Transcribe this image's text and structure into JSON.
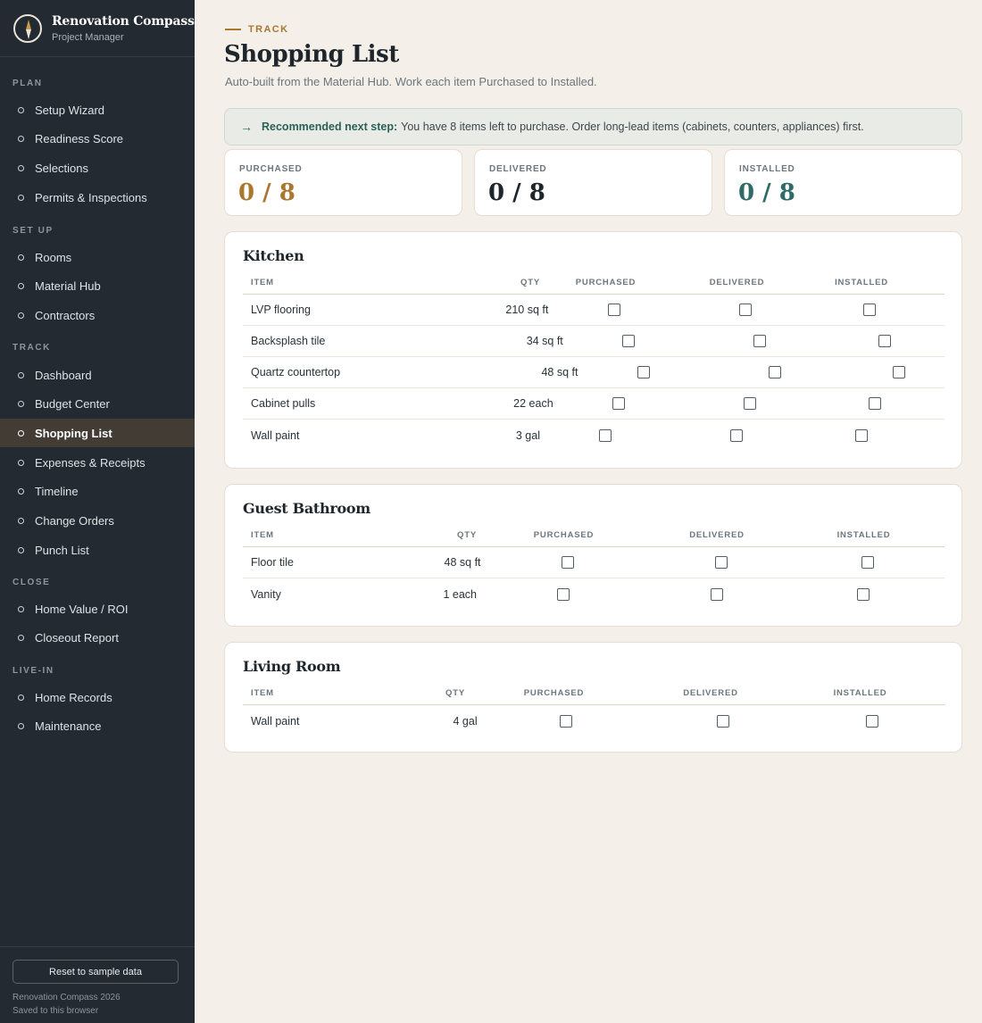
{
  "brand": {
    "title": "Renovation Compass",
    "subtitle": "Project Manager"
  },
  "nav": {
    "sections": [
      {
        "label": "PLAN",
        "items": [
          "Setup Wizard",
          "Readiness Score",
          "Selections",
          "Permits & Inspections"
        ]
      },
      {
        "label": "SET UP",
        "items": [
          "Rooms",
          "Material Hub",
          "Contractors"
        ]
      },
      {
        "label": "TRACK",
        "items": [
          "Dashboard",
          "Budget Center",
          "Shopping List",
          "Expenses & Receipts",
          "Timeline",
          "Change Orders",
          "Punch List"
        ]
      },
      {
        "label": "CLOSE",
        "items": [
          "Home Value / ROI",
          "Closeout Report"
        ]
      },
      {
        "label": "LIVE-IN",
        "items": [
          "Home Records",
          "Maintenance"
        ]
      }
    ],
    "active": "Shopping List"
  },
  "footer": {
    "reset_label": "Reset to sample data",
    "line1": "Renovation Compass 2026",
    "line2": "Saved to this browser"
  },
  "header": {
    "eyebrow": "TRACK",
    "title": "Shopping List",
    "subtitle": "Auto-built from the Material Hub. Work each item Purchased to Installed."
  },
  "recommendation": {
    "lead": "Recommended next step:",
    "text": "You have 8 items left to purchase. Order long-lead items (cabinets, counters, appliances) first."
  },
  "stats": [
    {
      "label": "PURCHASED",
      "value": "0 / 8",
      "color": "#a9772f"
    },
    {
      "label": "DELIVERED",
      "value": "0 / 8",
      "color": "#1e262c"
    },
    {
      "label": "INSTALLED",
      "value": "0 / 8",
      "color": "#2e6b68"
    }
  ],
  "columns": {
    "item": "ITEM",
    "qty": "QTY",
    "purchased": "PURCHASED",
    "delivered": "DELIVERED",
    "installed": "INSTALLED"
  },
  "rooms": [
    {
      "name": "Kitchen",
      "items": [
        {
          "item": "LVP flooring",
          "qty": "210 sq ft",
          "purchased": false,
          "delivered": false,
          "installed": false
        },
        {
          "item": "Backsplash tile",
          "qty": "34 sq ft",
          "purchased": false,
          "delivered": false,
          "installed": false
        },
        {
          "item": "Quartz countertop",
          "qty": "48 sq ft",
          "purchased": false,
          "delivered": false,
          "installed": false
        },
        {
          "item": "Cabinet pulls",
          "qty": "22 each",
          "purchased": false,
          "delivered": false,
          "installed": false
        },
        {
          "item": "Wall paint",
          "qty": "3 gal",
          "purchased": false,
          "delivered": false,
          "installed": false
        }
      ]
    },
    {
      "name": "Guest Bathroom",
      "items": [
        {
          "item": "Floor tile",
          "qty": "48 sq ft",
          "purchased": false,
          "delivered": false,
          "installed": false
        },
        {
          "item": "Vanity",
          "qty": "1 each",
          "purchased": false,
          "delivered": false,
          "installed": false
        }
      ]
    },
    {
      "name": "Living Room",
      "items": [
        {
          "item": "Wall paint",
          "qty": "4 gal",
          "purchased": false,
          "delivered": false,
          "installed": false
        }
      ]
    }
  ]
}
